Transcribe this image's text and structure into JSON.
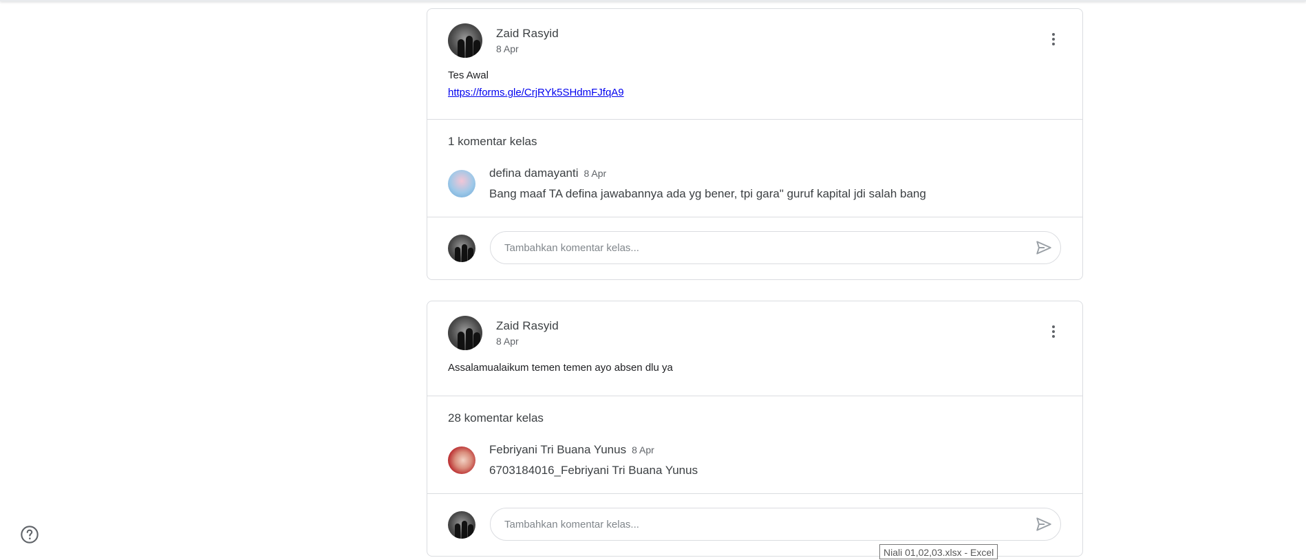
{
  "posts": [
    {
      "author": "Zaid Rasyid",
      "date": "8 Apr",
      "text": "Tes Awal",
      "link": "https://forms.gle/CrjRYk5SHdmFJfqA9",
      "comments_count": "1 komentar kelas",
      "comment": {
        "name": "defina damayanti",
        "date": "8 Apr",
        "text": "Bang maaf TA defina jawabannya ada yg bener, tpi gara\" guruf kapital jdi salah bang"
      },
      "add_comment_placeholder": "Tambahkan komentar kelas..."
    },
    {
      "author": "Zaid Rasyid",
      "date": "8 Apr",
      "text": "Assalamualaikum temen temen ayo absen dlu ya",
      "comments_count": "28 komentar kelas",
      "comment": {
        "name": "Febriyani Tri Buana Yunus",
        "date": "8 Apr",
        "text": "6703184016_Febriyani Tri Buana Yunus"
      },
      "add_comment_placeholder": "Tambahkan komentar kelas..."
    }
  ],
  "icons": {
    "more": "more-vert-icon",
    "send": "send-icon",
    "help": "help-icon"
  },
  "taskbar_tooltip": "Niali 01,02,03.xlsx - Excel"
}
